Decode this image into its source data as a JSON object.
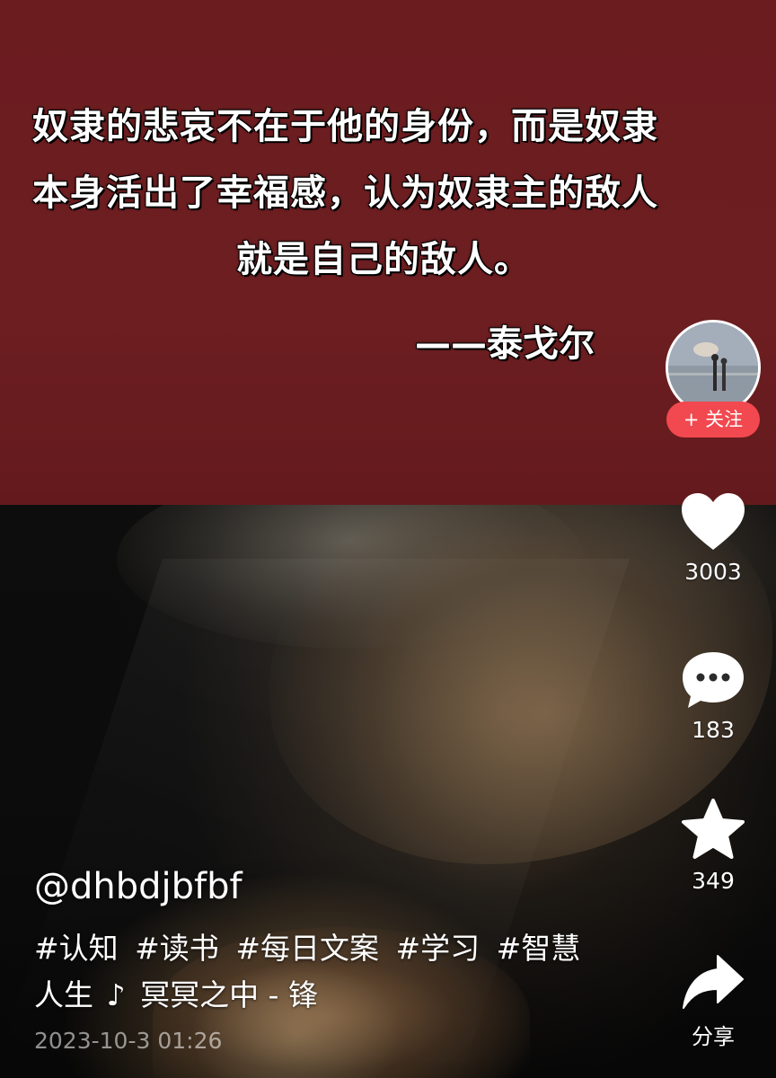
{
  "quote": {
    "lines": [
      "奴隶的悲哀不在于他的身份，而是奴隶",
      "本身活出了幸福感，认为奴隶主的敌人",
      "就是自己的敌人。"
    ],
    "author": "——泰戈尔"
  },
  "sidebar": {
    "follow_label": "+ 关注",
    "like_count": "3003",
    "comment_count": "183",
    "favorite_count": "349",
    "share_label": "分享"
  },
  "post": {
    "author": "@dhbdjbfbf",
    "tags": [
      "#认知",
      "#读书",
      "#每日文案",
      "#学习",
      "#智慧"
    ],
    "caption_continuation": "人生",
    "music_icon": "♪",
    "music": "冥冥之中 - 锋",
    "timestamp": "2023-10-3 01:26"
  },
  "colors": {
    "quote_background": "#6b1c1f",
    "follow_button": "#f2484f",
    "icon": "#ffffff"
  },
  "icons": {
    "like": "heart-icon",
    "comment": "comment-bubble-icon",
    "favorite": "star-icon",
    "share": "share-arrow-icon"
  }
}
